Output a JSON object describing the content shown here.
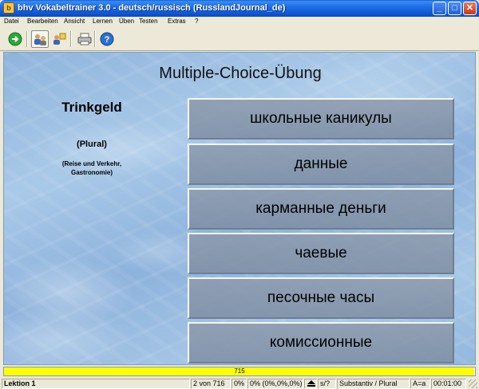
{
  "window": {
    "title": "bhv Vokabeltrainer 3.0 - deutsch/russisch (RusslandJournal_de)",
    "app_icon": "book-icon",
    "minimize_glyph": "_",
    "maximize_glyph": "□",
    "close_glyph": "✕"
  },
  "menu": [
    "Datei",
    "Bearbeiten",
    "Ansicht",
    "Lernen",
    "Üben",
    "Testen",
    "Extras",
    "?"
  ],
  "toolbar": {
    "buttons": [
      {
        "icon": "green-arrow-icon"
      },
      {
        "icon": "multiple-choice-icon",
        "pressed": true
      },
      {
        "icon": "flashcard-icon"
      },
      {
        "icon": "printer-icon"
      },
      {
        "icon": "help-icon"
      }
    ]
  },
  "exercise": {
    "heading": "Multiple-Choice-Übung",
    "word": "Trinkgeld",
    "grammar": "(Plural)",
    "topic": "(Reise und Verkehr,\nGastronomie)",
    "answers": [
      "школьные каникулы",
      "данные",
      "карманные деньги",
      "чаевые",
      "песочные часы",
      "комиссионные"
    ]
  },
  "progress": {
    "value": 715,
    "max": 716,
    "label": "715",
    "color": "#ffff00"
  },
  "status": {
    "lesson": "Lektion 1",
    "position": "2 von 716",
    "percent1": "0%",
    "percent2": "0% (0%,0%,0%)",
    "mode": "s/?",
    "word_type": "Substantiv / Plural",
    "case_mode": "A=a",
    "timer": "00:01:00"
  }
}
